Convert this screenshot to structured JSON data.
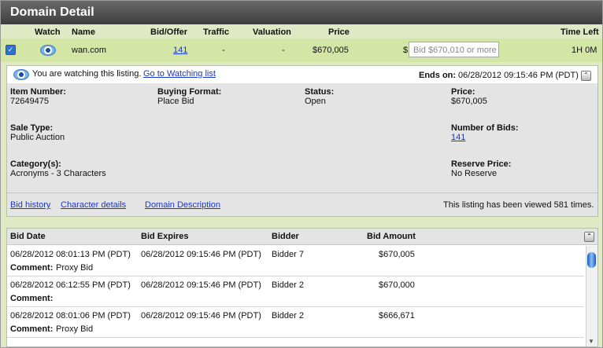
{
  "title": "Domain Detail",
  "columns": [
    "Watch",
    "Name",
    "Bid/Offer",
    "Traffic",
    "Valuation",
    "Price",
    "Time Left"
  ],
  "listing": {
    "checked": true,
    "name": "wan.com",
    "bids": "141",
    "traffic": "-",
    "valuation": "-",
    "price": "$670,005",
    "price_prefix": "$",
    "bid_placeholder": "Bid $670,010 or more",
    "time_left": "1H 0M"
  },
  "detail": {
    "watching_text": "You are watching this listing.",
    "watching_link": "Go to Watching list",
    "ends_label": "Ends on:",
    "ends_value": "06/28/2012 09:15:46 PM (PDT)",
    "item_number_label": "Item Number:",
    "item_number": "72649475",
    "buying_format_label": "Buying Format:",
    "buying_format": "Place Bid",
    "status_label": "Status:",
    "status": "Open",
    "price_label": "Price:",
    "price": "$670,005",
    "sale_type_label": "Sale Type:",
    "sale_type": "Public Auction",
    "num_bids_label": "Number of Bids:",
    "num_bids": "141",
    "category_label": "Category(s):",
    "category": "Acronyms - 3 Characters",
    "reserve_label": "Reserve Price:",
    "reserve": "No Reserve",
    "links": [
      "Bid history",
      "Character details",
      "Domain Description"
    ],
    "views_text": "This listing has been viewed 581 times."
  },
  "bid_table": {
    "headers": [
      "Bid Date",
      "Bid Expires",
      "Bidder",
      "Bid Amount"
    ],
    "comment_label": "Comment:",
    "rows": [
      {
        "date": "06/28/2012 08:01:13 PM (PDT)",
        "expires": "06/28/2012 09:15:46 PM (PDT)",
        "bidder": "Bidder 7",
        "amount": "$670,005",
        "comment": "Proxy Bid"
      },
      {
        "date": "06/28/2012 06:12:55 PM (PDT)",
        "expires": "06/28/2012 09:15:46 PM (PDT)",
        "bidder": "Bidder 2",
        "amount": "$670,000",
        "comment": ""
      },
      {
        "date": "06/28/2012 08:01:06 PM (PDT)",
        "expires": "06/28/2012 09:15:46 PM (PDT)",
        "bidder": "Bidder 2",
        "amount": "$666,671",
        "comment": "Proxy Bid"
      }
    ]
  },
  "colors": {
    "title_bg": "#4a4a4a",
    "panel_green": "#dfe9c4",
    "row_green": "#d4e6a6",
    "link": "#1a37c7"
  }
}
